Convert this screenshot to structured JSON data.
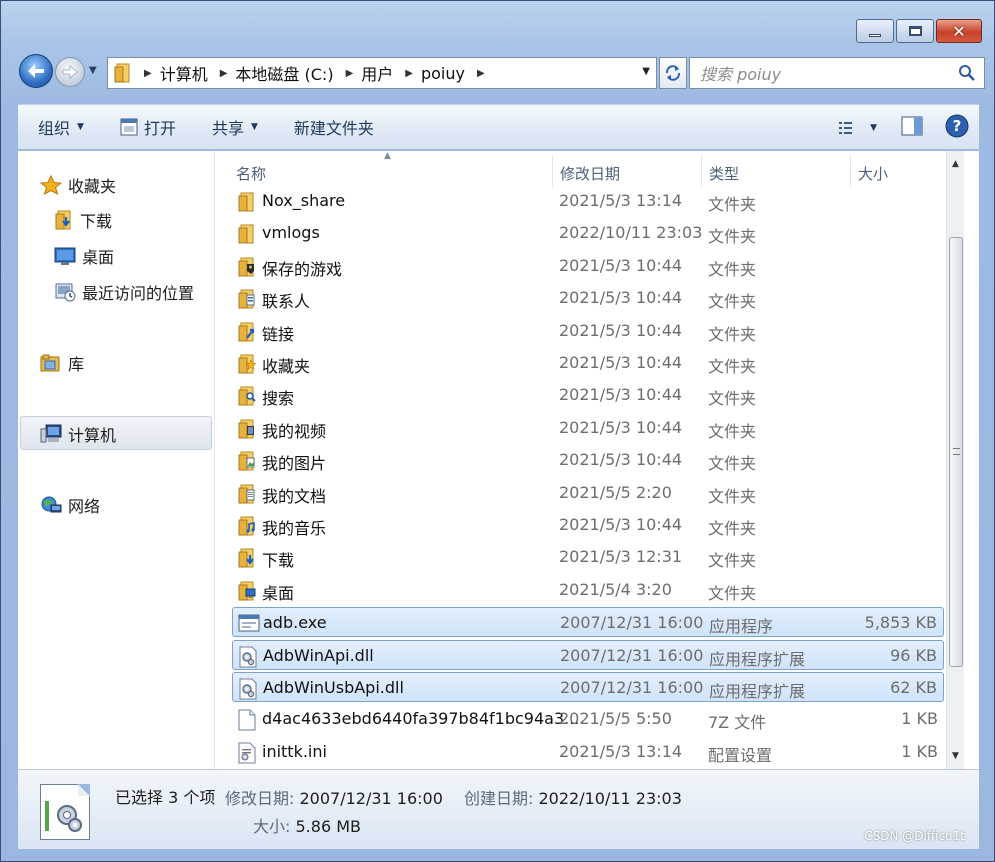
{
  "window": {
    "controls": {
      "minimize": "minimize",
      "maximize": "maximize",
      "close": "✕"
    }
  },
  "address": {
    "crumbs": [
      "计算机",
      "本地磁盘 (C:)",
      "用户",
      "poiuy"
    ],
    "search_placeholder": "搜索 poiuy"
  },
  "toolbar": {
    "organize": "组织",
    "open": "打开",
    "share": "共享",
    "new_folder": "新建文件夹"
  },
  "sidebar": {
    "favorites": "收藏夹",
    "downloads": "下载",
    "desktop": "桌面",
    "recent": "最近访问的位置",
    "libraries": "库",
    "computer": "计算机",
    "network": "网络"
  },
  "columns": {
    "name": "名称",
    "modified": "修改日期",
    "type": "类型",
    "size": "大小"
  },
  "files": [
    {
      "name": "Nox_share",
      "date": "2021/5/3 13:14",
      "type": "文件夹",
      "size": "",
      "icon": "folder-icon",
      "selected": false
    },
    {
      "name": "vmlogs",
      "date": "2022/10/11 23:03",
      "type": "文件夹",
      "size": "",
      "icon": "folder-icon",
      "selected": false
    },
    {
      "name": "保存的游戏",
      "date": "2021/5/3 10:44",
      "type": "文件夹",
      "size": "",
      "icon": "saved-games-folder-icon",
      "selected": false
    },
    {
      "name": "联系人",
      "date": "2021/5/3 10:44",
      "type": "文件夹",
      "size": "",
      "icon": "contacts-folder-icon",
      "selected": false
    },
    {
      "name": "链接",
      "date": "2021/5/3 10:44",
      "type": "文件夹",
      "size": "",
      "icon": "links-folder-icon",
      "selected": false
    },
    {
      "name": "收藏夹",
      "date": "2021/5/3 10:44",
      "type": "文件夹",
      "size": "",
      "icon": "favorites-folder-icon",
      "selected": false
    },
    {
      "name": "搜索",
      "date": "2021/5/3 10:44",
      "type": "文件夹",
      "size": "",
      "icon": "searches-folder-icon",
      "selected": false
    },
    {
      "name": "我的视频",
      "date": "2021/5/3 10:44",
      "type": "文件夹",
      "size": "",
      "icon": "videos-folder-icon",
      "selected": false
    },
    {
      "name": "我的图片",
      "date": "2021/5/3 10:44",
      "type": "文件夹",
      "size": "",
      "icon": "pictures-folder-icon",
      "selected": false
    },
    {
      "name": "我的文档",
      "date": "2021/5/5 2:20",
      "type": "文件夹",
      "size": "",
      "icon": "documents-folder-icon",
      "selected": false
    },
    {
      "name": "我的音乐",
      "date": "2021/5/3 10:44",
      "type": "文件夹",
      "size": "",
      "icon": "music-folder-icon",
      "selected": false
    },
    {
      "name": "下载",
      "date": "2021/5/3 12:31",
      "type": "文件夹",
      "size": "",
      "icon": "downloads-folder-icon",
      "selected": false
    },
    {
      "name": "桌面",
      "date": "2021/5/4 3:20",
      "type": "文件夹",
      "size": "",
      "icon": "desktop-folder-icon",
      "selected": false
    },
    {
      "name": "adb.exe",
      "date": "2007/12/31 16:00",
      "type": "应用程序",
      "size": "5,853 KB",
      "icon": "exe-icon",
      "selected": true
    },
    {
      "name": "AdbWinApi.dll",
      "date": "2007/12/31 16:00",
      "type": "应用程序扩展",
      "size": "96 KB",
      "icon": "dll-icon",
      "selected": true
    },
    {
      "name": "AdbWinUsbApi.dll",
      "date": "2007/12/31 16:00",
      "type": "应用程序扩展",
      "size": "62 KB",
      "icon": "dll-icon",
      "selected": true
    },
    {
      "name": "d4ac4633ebd6440fa397b84f1bc94a3...",
      "date": "2021/5/5 5:50",
      "type": "7Z 文件",
      "size": "1 KB",
      "icon": "file-icon",
      "selected": false
    },
    {
      "name": "inittk.ini",
      "date": "2021/5/3 13:14",
      "type": "配置设置",
      "size": "1 KB",
      "icon": "ini-icon",
      "selected": false
    }
  ],
  "details": {
    "selected_count": "已选择 3 个项",
    "modified_label": "修改日期:",
    "modified_value": "2007/12/31 16:00",
    "created_label": "创建日期:",
    "created_value": "2022/10/11 23:03",
    "size_label": "大小:",
    "size_value": "5.86 MB"
  },
  "watermark": "CSDN @Difficu1t",
  "colors": {
    "selection": "#cfe3fa",
    "selection_border": "#7da2ce",
    "folder": "#e9b949"
  }
}
